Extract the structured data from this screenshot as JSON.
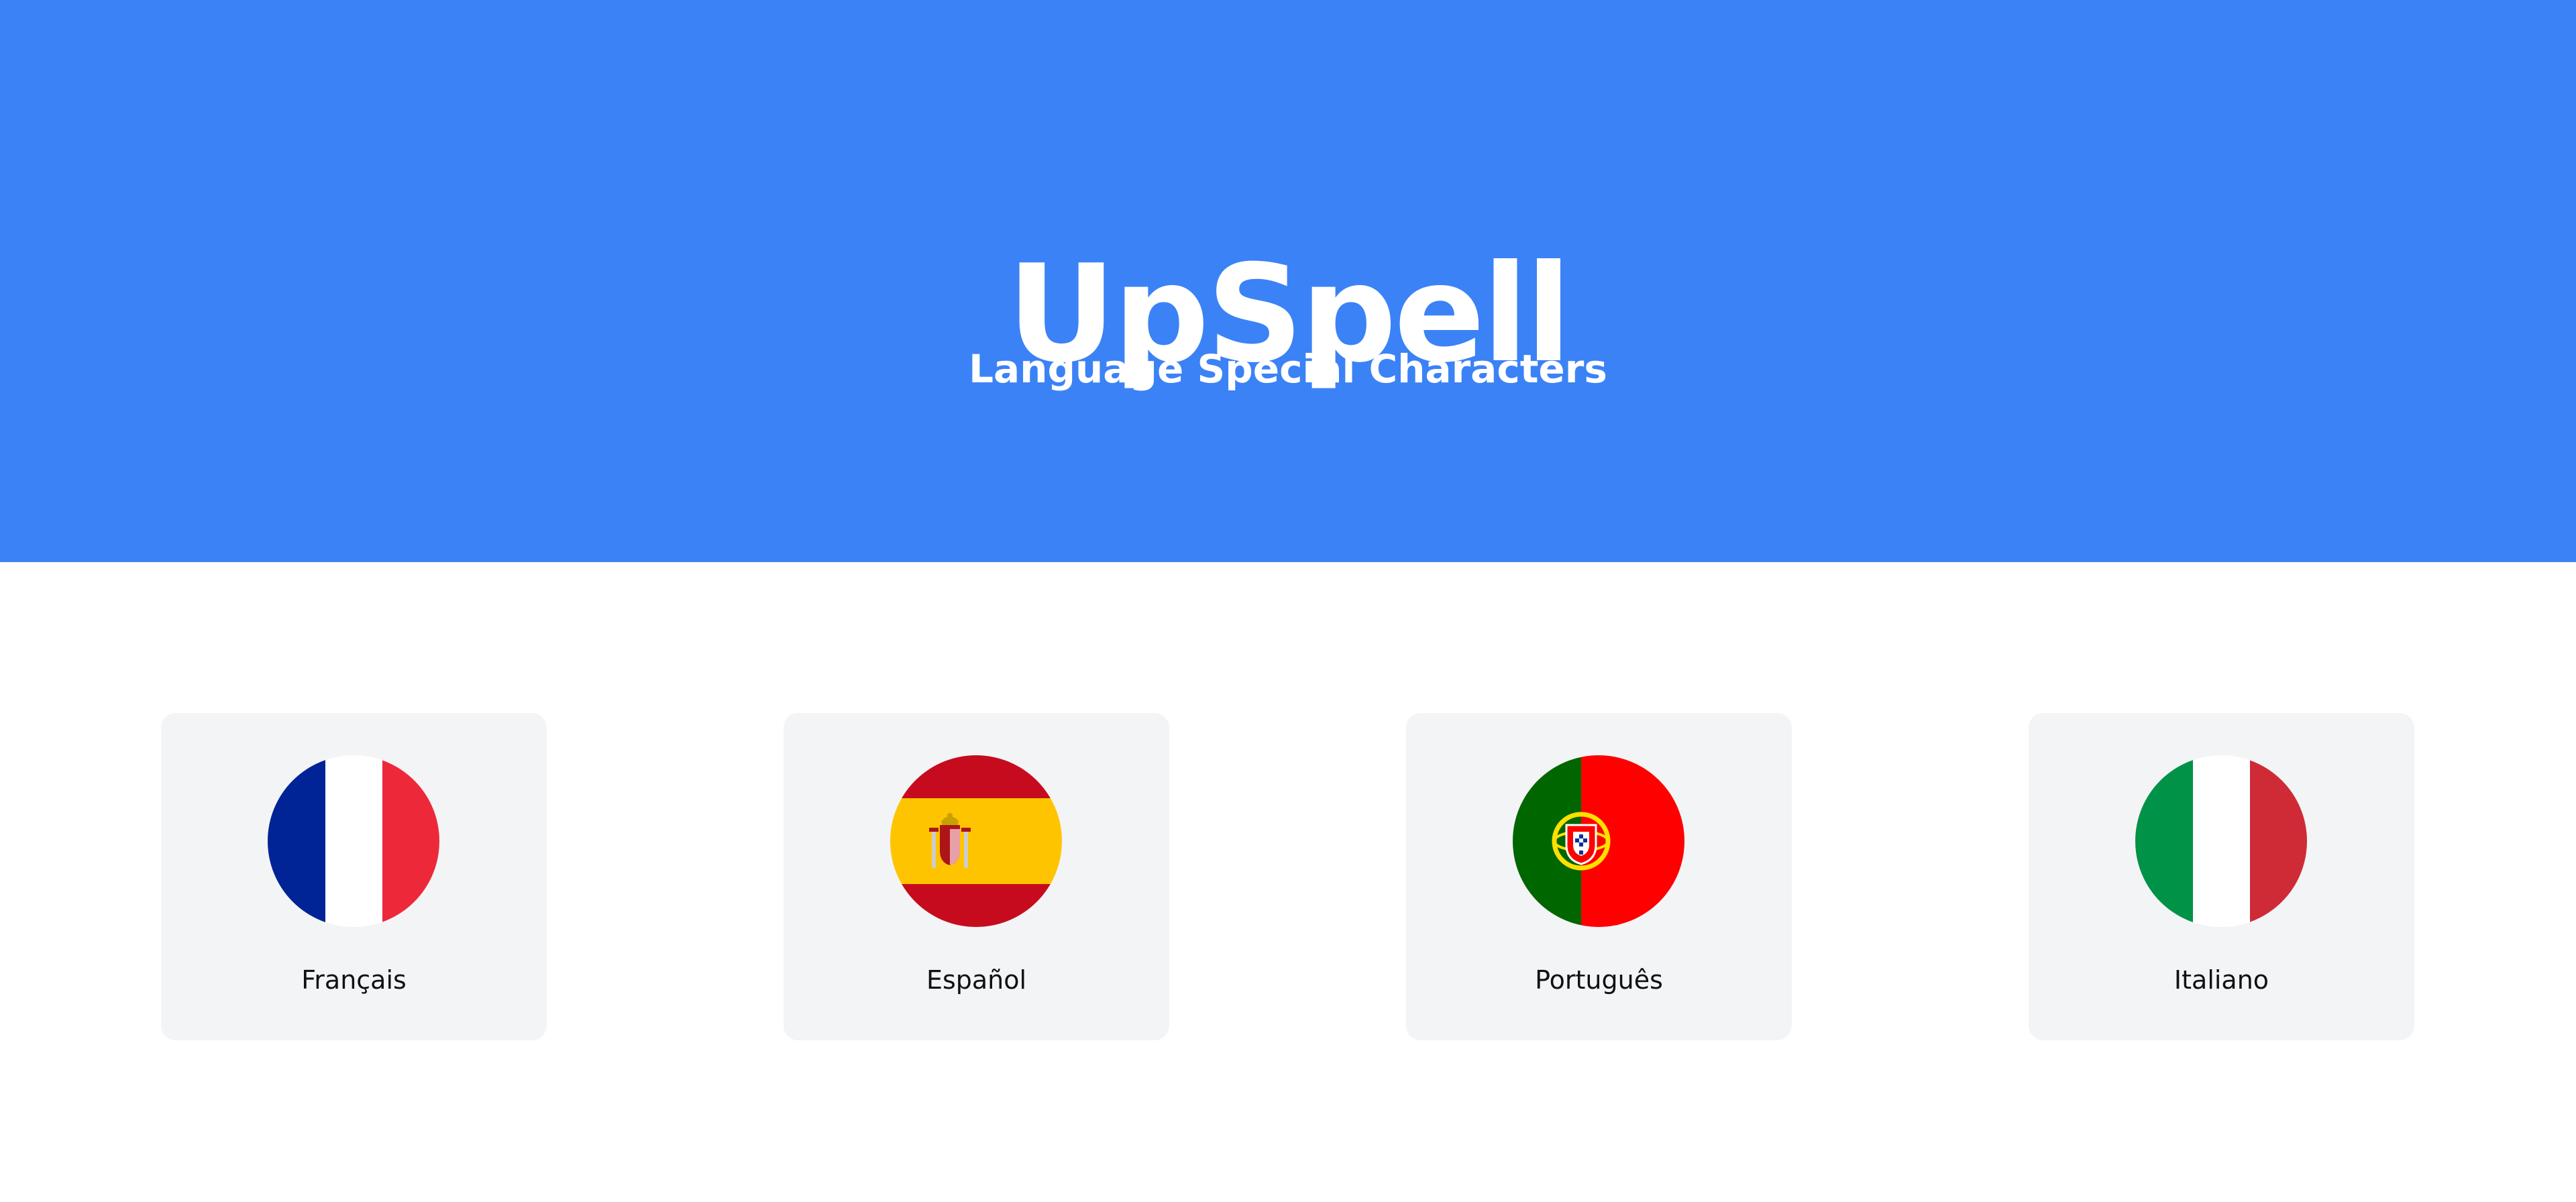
{
  "header": {
    "title": "UpSpell",
    "subtitle": "Language Special Characters"
  },
  "languages": [
    {
      "label": "Français",
      "flag_icon": "flag-france-icon"
    },
    {
      "label": "Español",
      "flag_icon": "flag-spain-icon"
    },
    {
      "label": "Português",
      "flag_icon": "flag-portugal-icon"
    },
    {
      "label": "Italiano",
      "flag_icon": "flag-italy-icon"
    }
  ],
  "colors": {
    "header_background": "#3b82f6",
    "card_background": "#f3f4f6",
    "header_text": "#ffffff",
    "label_text": "#111111"
  }
}
